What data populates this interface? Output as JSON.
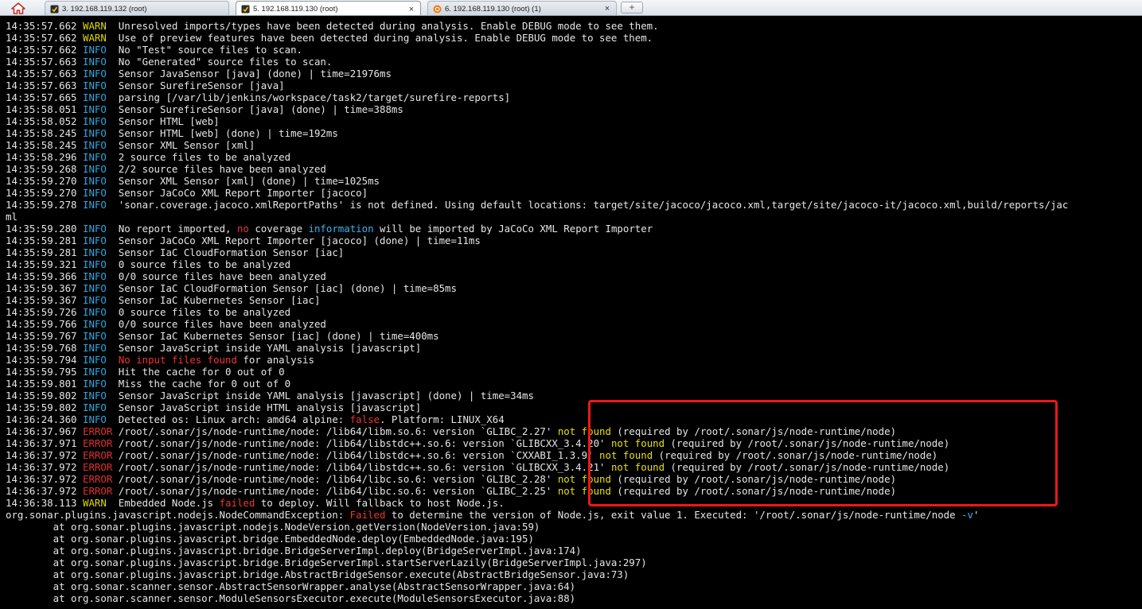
{
  "tabs": [
    {
      "label": "3. 192.168.119.132 (root)",
      "icon": "terminal-icon",
      "active": false,
      "closable": false
    },
    {
      "label": "5. 192.168.119.130 (root)",
      "icon": "terminal-icon",
      "active": true,
      "closable": true
    },
    {
      "label": "6. 192.168.119.130 (root) (1)",
      "icon": "ubuntu-session-icon",
      "active": false,
      "closable": true
    }
  ],
  "new_tab_label": "+",
  "close_glyph": "×",
  "colors": {
    "warn": "#e0d800",
    "info": "#2aa9e0",
    "error": "#e03030",
    "highlight_box": "#f01818",
    "background": "#000000"
  },
  "lines": [
    {
      "t": "14:35:57.662",
      "l": "WARN",
      "m": [
        [
          "Unresolved imports/types have been detected during analysis. Enable DEBUG mode to see them.",
          ""
        ]
      ]
    },
    {
      "t": "14:35:57.662",
      "l": "WARN",
      "m": [
        [
          "Use of preview features have been detected during analysis. Enable DEBUG mode to see them.",
          ""
        ]
      ]
    },
    {
      "t": "14:35:57.662",
      "l": "INFO",
      "m": [
        [
          "No \"Test\" source files to scan.",
          ""
        ]
      ]
    },
    {
      "t": "14:35:57.663",
      "l": "INFO",
      "m": [
        [
          "No \"Generated\" source files to scan.",
          ""
        ]
      ]
    },
    {
      "t": "14:35:57.663",
      "l": "INFO",
      "m": [
        [
          "Sensor JavaSensor [java] (done) | time=21976ms",
          ""
        ]
      ]
    },
    {
      "t": "14:35:57.663",
      "l": "INFO",
      "m": [
        [
          "Sensor SurefireSensor [java]",
          ""
        ]
      ]
    },
    {
      "t": "14:35:57.665",
      "l": "INFO",
      "m": [
        [
          "parsing [/var/lib/jenkins/workspace/task2/target/surefire-reports]",
          ""
        ]
      ]
    },
    {
      "t": "14:35:58.051",
      "l": "INFO",
      "m": [
        [
          "Sensor SurefireSensor [java] (done) | time=388ms",
          ""
        ]
      ]
    },
    {
      "t": "14:35:58.052",
      "l": "INFO",
      "m": [
        [
          "Sensor HTML [web]",
          ""
        ]
      ]
    },
    {
      "t": "14:35:58.245",
      "l": "INFO",
      "m": [
        [
          "Sensor HTML [web] (done) | time=192ms",
          ""
        ]
      ]
    },
    {
      "t": "14:35:58.245",
      "l": "INFO",
      "m": [
        [
          "Sensor XML Sensor [xml]",
          ""
        ]
      ]
    },
    {
      "t": "14:35:58.296",
      "l": "INFO",
      "m": [
        [
          "2 source files to be analyzed",
          ""
        ]
      ]
    },
    {
      "t": "14:35:59.268",
      "l": "INFO",
      "m": [
        [
          "2/2 source files have been analyzed",
          ""
        ]
      ]
    },
    {
      "t": "14:35:59.270",
      "l": "INFO",
      "m": [
        [
          "Sensor XML Sensor [xml] (done) | time=1025ms",
          ""
        ]
      ]
    },
    {
      "t": "14:35:59.270",
      "l": "INFO",
      "m": [
        [
          "Sensor JaCoCo XML Report Importer [jacoco]",
          ""
        ]
      ]
    },
    {
      "t": "14:35:59.278",
      "l": "INFO",
      "m": [
        [
          "'sonar.coverage.jacoco.xmlReportPaths' is not defined. Using default locations: target/site/jacoco/jacoco.xml,target/site/jacoco-it/jacoco.xml,build/reports/jac",
          ""
        ]
      ]
    },
    {
      "t": "",
      "l": "",
      "m": [
        [
          "ml",
          ""
        ]
      ]
    },
    {
      "t": "14:35:59.280",
      "l": "INFO",
      "m": [
        [
          "No report imported, ",
          ""
        ],
        [
          "no",
          "hl-red"
        ],
        [
          " coverage ",
          ""
        ],
        [
          "information",
          "hl-cyan"
        ],
        [
          " will be imported by JaCoCo XML Report Importer",
          ""
        ]
      ]
    },
    {
      "t": "14:35:59.281",
      "l": "INFO",
      "m": [
        [
          "Sensor JaCoCo XML Report Importer [jacoco] (done) | time=11ms",
          ""
        ]
      ]
    },
    {
      "t": "14:35:59.281",
      "l": "INFO",
      "m": [
        [
          "Sensor IaC CloudFormation Sensor [iac]",
          ""
        ]
      ]
    },
    {
      "t": "14:35:59.321",
      "l": "INFO",
      "m": [
        [
          "0 source files to be analyzed",
          ""
        ]
      ]
    },
    {
      "t": "14:35:59.366",
      "l": "INFO",
      "m": [
        [
          "0/0 source files have been analyzed",
          ""
        ]
      ]
    },
    {
      "t": "14:35:59.367",
      "l": "INFO",
      "m": [
        [
          "Sensor IaC CloudFormation Sensor [iac] (done) | time=85ms",
          ""
        ]
      ]
    },
    {
      "t": "14:35:59.367",
      "l": "INFO",
      "m": [
        [
          "Sensor IaC Kubernetes Sensor [iac]",
          ""
        ]
      ]
    },
    {
      "t": "14:35:59.726",
      "l": "INFO",
      "m": [
        [
          "0 source files to be analyzed",
          ""
        ]
      ]
    },
    {
      "t": "14:35:59.766",
      "l": "INFO",
      "m": [
        [
          "0/0 source files have been analyzed",
          ""
        ]
      ]
    },
    {
      "t": "14:35:59.767",
      "l": "INFO",
      "m": [
        [
          "Sensor IaC Kubernetes Sensor [iac] (done) | time=400ms",
          ""
        ]
      ]
    },
    {
      "t": "14:35:59.768",
      "l": "INFO",
      "m": [
        [
          "Sensor JavaScript inside YAML analysis [javascript]",
          ""
        ]
      ]
    },
    {
      "t": "14:35:59.794",
      "l": "INFO",
      "m": [
        [
          "No input files found",
          "hl-red"
        ],
        [
          " for analysis",
          ""
        ]
      ]
    },
    {
      "t": "14:35:59.795",
      "l": "INFO",
      "m": [
        [
          "Hit the cache for 0 out of 0",
          ""
        ]
      ]
    },
    {
      "t": "14:35:59.801",
      "l": "INFO",
      "m": [
        [
          "Miss the cache for 0 out of 0",
          ""
        ]
      ]
    },
    {
      "t": "14:35:59.802",
      "l": "INFO",
      "m": [
        [
          "Sensor JavaScript inside YAML analysis [javascript] (done) | time=34ms",
          ""
        ]
      ]
    },
    {
      "t": "14:35:59.802",
      "l": "INFO",
      "m": [
        [
          "Sensor JavaScript inside HTML analysis [javascript]",
          ""
        ]
      ]
    },
    {
      "t": "14:36:24.360",
      "l": "INFO",
      "m": [
        [
          "Detected os: Linux arch: amd64 alpine: ",
          ""
        ],
        [
          "false",
          "hl-red"
        ],
        [
          ". Platform: LINUX_X64",
          ""
        ]
      ]
    },
    {
      "t": "14:36:37.967",
      "l": "ERROR",
      "m": [
        [
          "/root/.sonar/js/node-runtime/node: /lib64/libm.so.6: version `GLIBC_2.27' ",
          ""
        ],
        [
          "not found",
          "hl-yellow"
        ],
        [
          " (required by /root/.sonar/js/node-runtime/node)",
          ""
        ]
      ]
    },
    {
      "t": "14:36:37.971",
      "l": "ERROR",
      "m": [
        [
          "/root/.sonar/js/node-runtime/node: /lib64/libstdc++.so.6: version `GLIBCXX_3.4.20' ",
          ""
        ],
        [
          "not found",
          "hl-yellow"
        ],
        [
          " (required by /root/.sonar/js/node-runtime/node)",
          ""
        ]
      ]
    },
    {
      "t": "14:36:37.972",
      "l": "ERROR",
      "m": [
        [
          "/root/.sonar/js/node-runtime/node: /lib64/libstdc++.so.6: version `CXXABI_1.3.9' ",
          ""
        ],
        [
          "not found",
          "hl-yellow"
        ],
        [
          " (required by /root/.sonar/js/node-runtime/node)",
          ""
        ]
      ]
    },
    {
      "t": "14:36:37.972",
      "l": "ERROR",
      "m": [
        [
          "/root/.sonar/js/node-runtime/node: /lib64/libstdc++.so.6: version `GLIBCXX_3.4.21' ",
          ""
        ],
        [
          "not found",
          "hl-yellow"
        ],
        [
          " (required by /root/.sonar/js/node-runtime/node)",
          ""
        ]
      ]
    },
    {
      "t": "14:36:37.972",
      "l": "ERROR",
      "m": [
        [
          "/root/.sonar/js/node-runtime/node: /lib64/libc.so.6: version `GLIBC_2.28' ",
          ""
        ],
        [
          "not found",
          "hl-yellow"
        ],
        [
          " (required by /root/.sonar/js/node-runtime/node)",
          ""
        ]
      ]
    },
    {
      "t": "14:36:37.972",
      "l": "ERROR",
      "m": [
        [
          "/root/.sonar/js/node-runtime/node: /lib64/libc.so.6: version `GLIBC_2.25' ",
          ""
        ],
        [
          "not found",
          "hl-yellow"
        ],
        [
          " (required by /root/.sonar/js/node-runtime/node)",
          ""
        ]
      ]
    },
    {
      "t": "14:36:38.113",
      "l": "WARN",
      "m": [
        [
          "Embedded Node.js ",
          ""
        ],
        [
          "failed",
          "hl-red"
        ],
        [
          " to deploy. Will fallback to host Node.js.",
          ""
        ]
      ]
    },
    {
      "t": "",
      "l": "",
      "m": [
        [
          "org.sonar.plugins.javascript.nodejs.NodeCommandException: ",
          ""
        ],
        [
          "Failed",
          "hl-red"
        ],
        [
          " to determine the version of Node.js, exit value 1. Executed: '/root/.sonar/js/node-runtime/node ",
          ""
        ],
        [
          "-v",
          "hl-cyan"
        ],
        [
          "'",
          ""
        ]
      ]
    },
    {
      "t": "",
      "l": "",
      "m": [
        [
          "        at org.sonar.plugins.javascript.nodejs.NodeVersion.getVersion(NodeVersion.java:59)",
          ""
        ]
      ]
    },
    {
      "t": "",
      "l": "",
      "m": [
        [
          "        at org.sonar.plugins.javascript.bridge.EmbeddedNode.deploy(EmbeddedNode.java:195)",
          ""
        ]
      ]
    },
    {
      "t": "",
      "l": "",
      "m": [
        [
          "        at org.sonar.plugins.javascript.bridge.BridgeServerImpl.deploy(BridgeServerImpl.java:174)",
          ""
        ]
      ]
    },
    {
      "t": "",
      "l": "",
      "m": [
        [
          "        at org.sonar.plugins.javascript.bridge.BridgeServerImpl.startServerLazily(BridgeServerImpl.java:297)",
          ""
        ]
      ]
    },
    {
      "t": "",
      "l": "",
      "m": [
        [
          "        at org.sonar.plugins.javascript.bridge.AbstractBridgeSensor.execute(AbstractBridgeSensor.java:73)",
          ""
        ]
      ]
    },
    {
      "t": "",
      "l": "",
      "m": [
        [
          "        at org.sonar.scanner.sensor.AbstractSensorWrapper.analyse(AbstractSensorWrapper.java:64)",
          ""
        ]
      ]
    },
    {
      "t": "",
      "l": "",
      "m": [
        [
          "        at org.sonar.scanner.sensor.ModuleSensorsExecutor.execute(ModuleSensorsExecutor.java:88)",
          ""
        ]
      ]
    }
  ]
}
